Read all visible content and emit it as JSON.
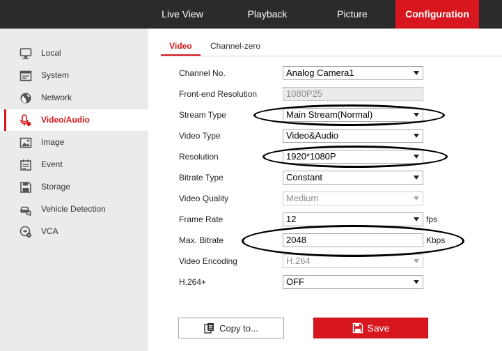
{
  "topnav": {
    "items": [
      {
        "label": "Live View"
      },
      {
        "label": "Playback"
      },
      {
        "label": "Picture"
      },
      {
        "label": "Configuration"
      }
    ]
  },
  "sidebar": {
    "items": [
      {
        "label": "Local",
        "icon": "monitor-icon"
      },
      {
        "label": "System",
        "icon": "system-icon"
      },
      {
        "label": "Network",
        "icon": "globe-icon"
      },
      {
        "label": "Video/Audio",
        "icon": "mic-camera-icon"
      },
      {
        "label": "Image",
        "icon": "image-icon"
      },
      {
        "label": "Event",
        "icon": "event-icon"
      },
      {
        "label": "Storage",
        "icon": "storage-icon"
      },
      {
        "label": "Vehicle Detection",
        "icon": "vehicle-detection-icon"
      },
      {
        "label": "VCA",
        "icon": "vca-icon"
      }
    ],
    "active": "Video/Audio"
  },
  "tabs": [
    {
      "label": "Video"
    },
    {
      "label": "Channel-zero"
    }
  ],
  "form": {
    "channel_no": {
      "label": "Channel No.",
      "value": "Analog Camera1"
    },
    "front_end_resolution": {
      "label": "Front-end Resolution",
      "value": "1080P25"
    },
    "stream_type": {
      "label": "Stream Type",
      "value": "Main Stream(Normal)"
    },
    "video_type": {
      "label": "Video Type",
      "value": "Video&Audio"
    },
    "resolution": {
      "label": "Resolution",
      "value": "1920*1080P"
    },
    "bitrate_type": {
      "label": "Bitrate Type",
      "value": "Constant"
    },
    "video_quality": {
      "label": "Video Quality",
      "value": "Medium"
    },
    "frame_rate": {
      "label": "Frame Rate",
      "value": "12",
      "unit": "fps"
    },
    "max_bitrate": {
      "label": "Max. Bitrate",
      "value": "2048",
      "unit": "Kbps"
    },
    "video_encoding": {
      "label": "Video Encoding",
      "value": "H.264"
    },
    "h264_plus": {
      "label": "H.264+",
      "value": "OFF"
    }
  },
  "buttons": {
    "copy_label": "Copy to...",
    "save_label": "Save"
  },
  "colors": {
    "accent": "#d7161e",
    "topbar": "#2b2b2b",
    "sidebar": "#ebebeb"
  }
}
